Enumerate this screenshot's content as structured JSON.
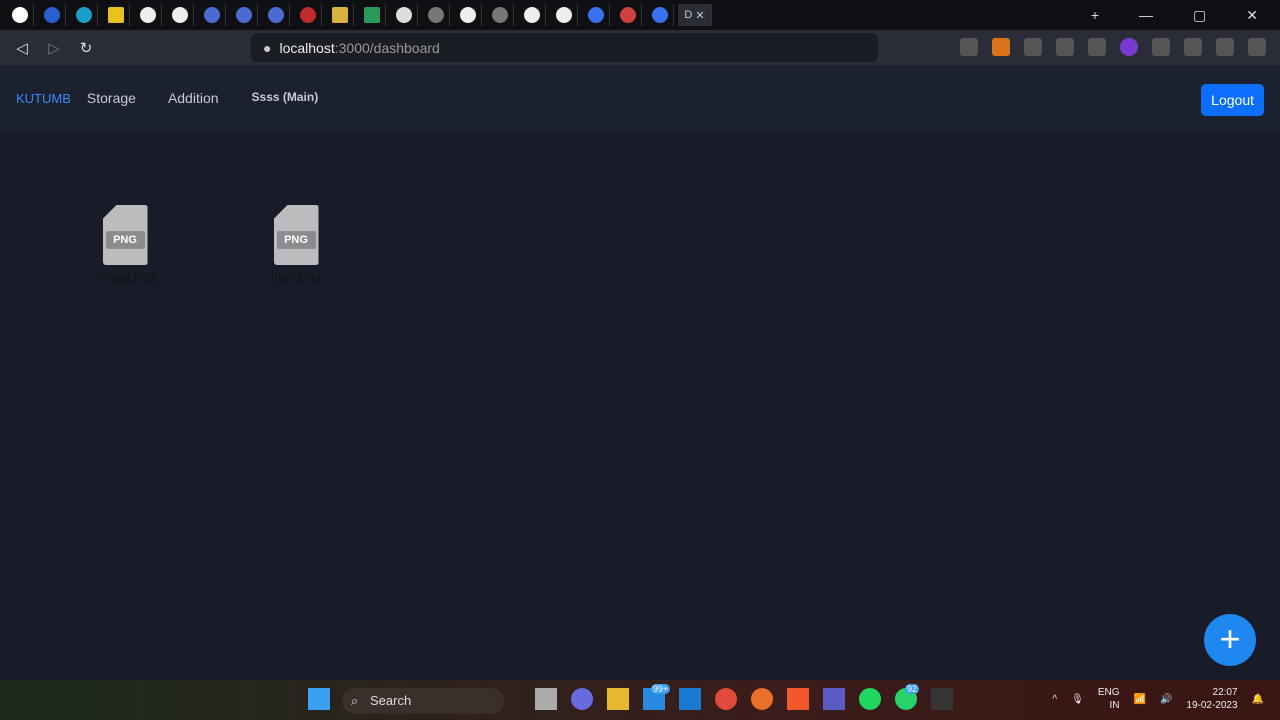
{
  "browser": {
    "url_host": "localhost",
    "url_path": ":3000/dashboard",
    "active_tab_label": "D"
  },
  "navbar": {
    "brand": "KUTUMB",
    "links": [
      "Storage",
      "Addition"
    ],
    "current_folder": "Ssss (Main)",
    "logout_label": "Logout"
  },
  "files": [
    {
      "name": "image.png",
      "type": "PNG"
    },
    {
      "name": "logo.png",
      "type": "PNG"
    }
  ],
  "fab": {
    "icon": "plus-icon",
    "label": "+"
  },
  "taskbar": {
    "search_label": "Search",
    "mail_badge": "99+",
    "whatsapp_badge": "92",
    "lang": "ENG",
    "region": "IN",
    "time": "22:07",
    "date": "19-02-2023"
  },
  "colors": {
    "accent": "#0d6efd",
    "brand": "#3d8af7",
    "background": "#171c28"
  }
}
